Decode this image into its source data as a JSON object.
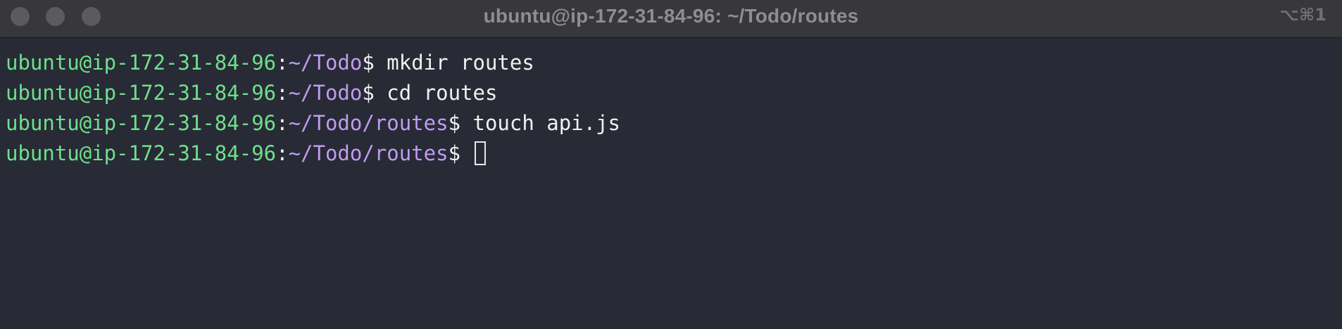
{
  "window": {
    "title": "ubuntu@ip-172-31-84-96: ~/Todo/routes",
    "shortcut": "⌥⌘1"
  },
  "colors": {
    "titlebar_bg": "#38383b",
    "terminal_bg": "#282a36",
    "prompt_user": "#6ee08a",
    "prompt_path": "#c09cf0",
    "text": "#f1f1ef"
  },
  "terminal": {
    "lines": [
      {
        "user": "ubuntu@ip-172-31-84-96",
        "colon": ":",
        "path": "~/Todo",
        "dollar": "$",
        "command": " mkdir routes"
      },
      {
        "user": "ubuntu@ip-172-31-84-96",
        "colon": ":",
        "path": "~/Todo",
        "dollar": "$",
        "command": " cd routes"
      },
      {
        "user": "ubuntu@ip-172-31-84-96",
        "colon": ":",
        "path": "~/Todo/routes",
        "dollar": "$",
        "command": " touch api.js"
      },
      {
        "user": "ubuntu@ip-172-31-84-96",
        "colon": ":",
        "path": "~/Todo/routes",
        "dollar": "$",
        "command": " "
      }
    ]
  }
}
